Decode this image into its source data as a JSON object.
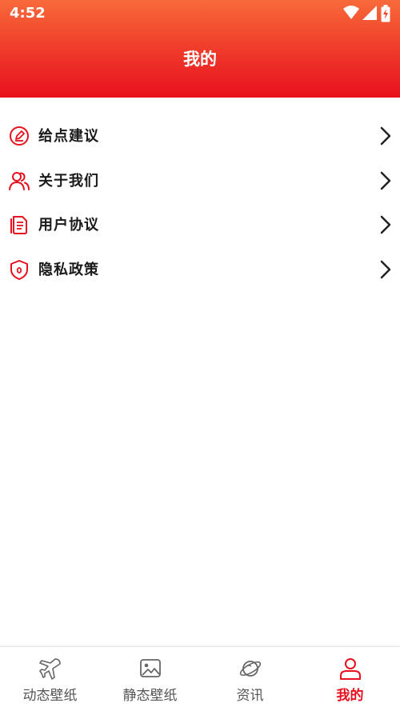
{
  "status_bar": {
    "time": "4:52"
  },
  "header": {
    "title": "我的"
  },
  "menu": {
    "items": [
      {
        "label": "给点建议",
        "icon": "edit-circle-icon"
      },
      {
        "label": "关于我们",
        "icon": "users-icon"
      },
      {
        "label": "用户协议",
        "icon": "document-icon"
      },
      {
        "label": "隐私政策",
        "icon": "shield-icon"
      }
    ]
  },
  "tabbar": {
    "tabs": [
      {
        "label": "动态壁纸",
        "icon": "plane-icon",
        "active": false
      },
      {
        "label": "静态壁纸",
        "icon": "image-icon",
        "active": false
      },
      {
        "label": "资讯",
        "icon": "planet-icon",
        "active": false
      },
      {
        "label": "我的",
        "icon": "person-icon",
        "active": true
      }
    ]
  },
  "colors": {
    "accent": "#e8101e",
    "header_top": "#f86a3a",
    "text": "#1a1a1a",
    "tab_inactive": "#555555"
  }
}
